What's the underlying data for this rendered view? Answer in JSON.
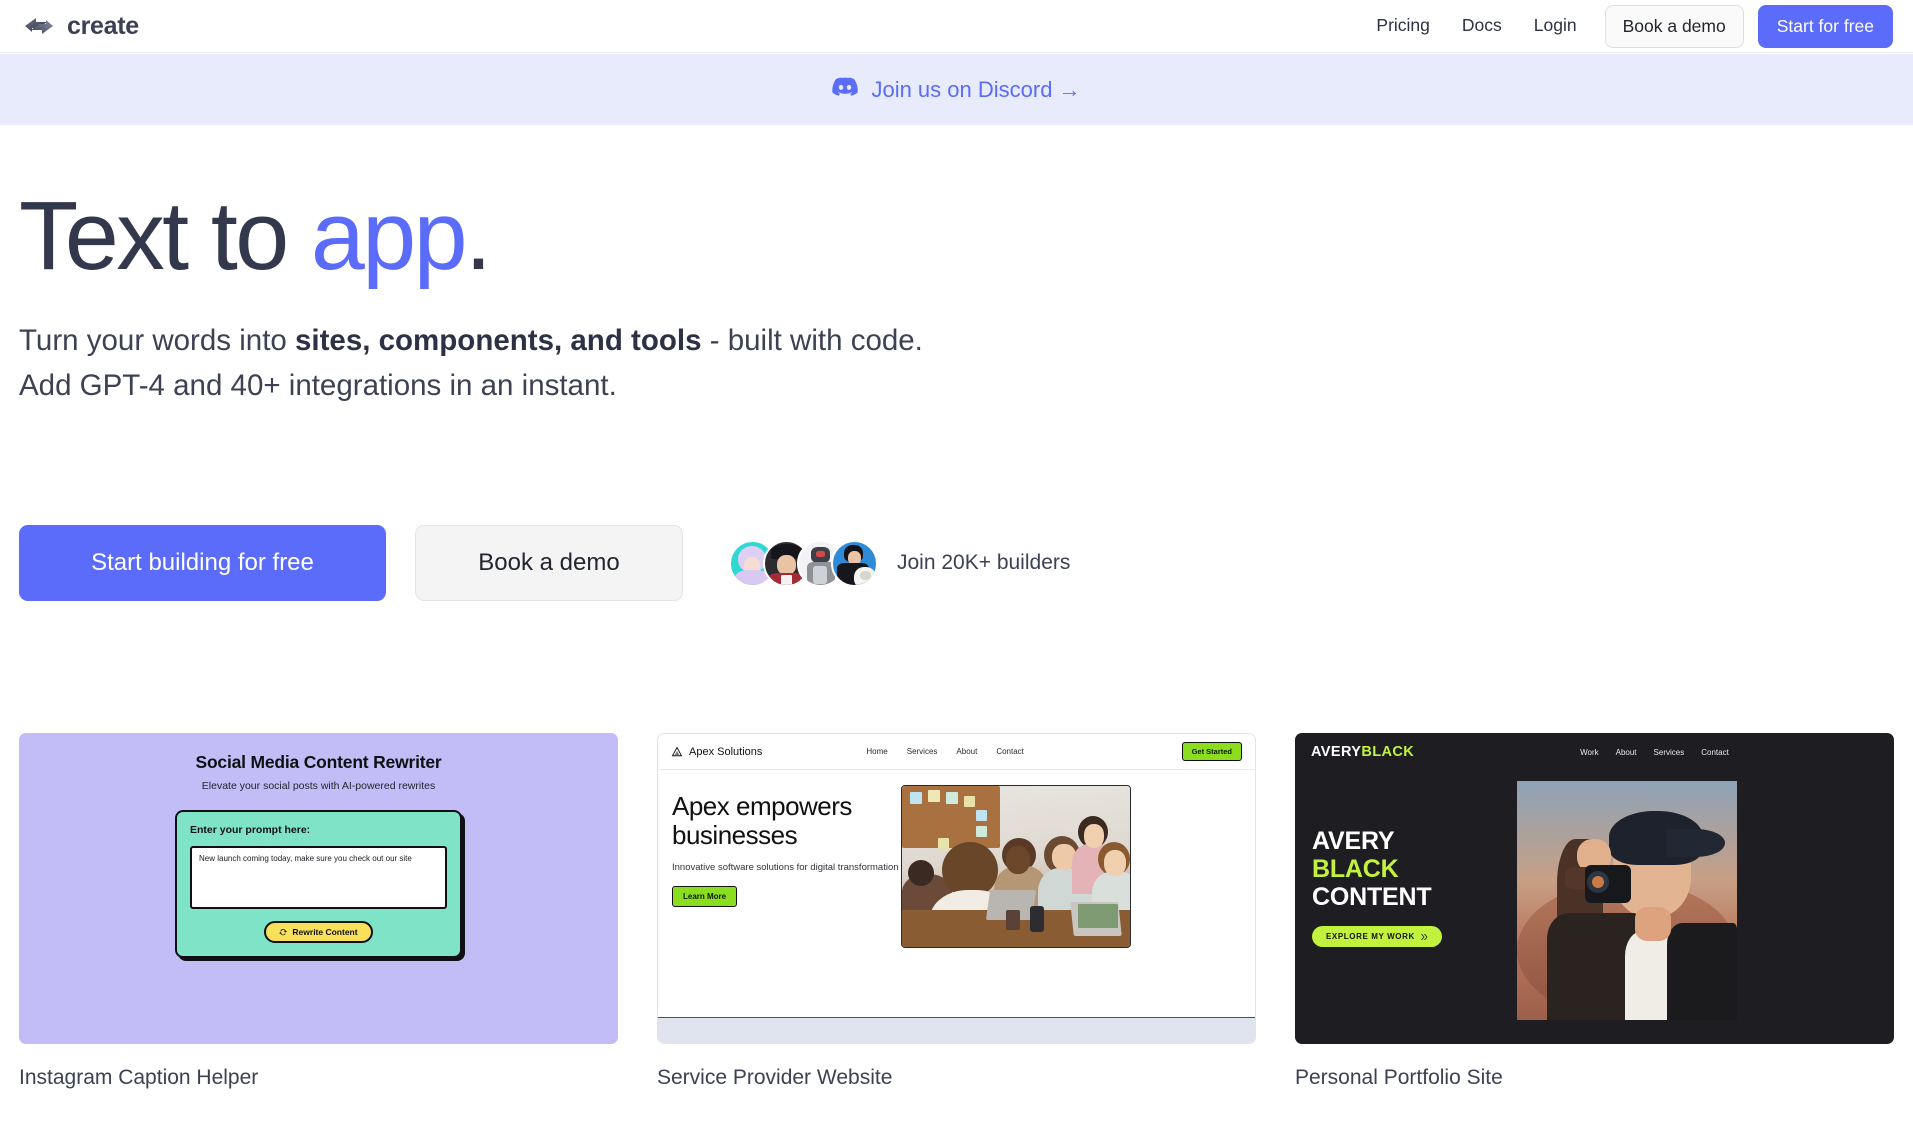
{
  "brand": {
    "name": "create",
    "logo_icon": "create-logo-icon"
  },
  "nav": {
    "links": [
      {
        "label": "Pricing"
      },
      {
        "label": "Docs"
      },
      {
        "label": "Login"
      }
    ],
    "book_demo": "Book a demo",
    "start_free": "Start for free"
  },
  "banner": {
    "icon": "discord-icon",
    "text": "Join us on Discord →",
    "bg_color": "#e8ebfb",
    "text_color": "#5b6bfa"
  },
  "hero": {
    "headline_plain": "Text to ",
    "headline_accent": "app",
    "headline_period": ".",
    "accent_color": "#5b6bfa",
    "sub_line1_a": "Turn your words into ",
    "sub_line1_b": "sites, components, and tools",
    "sub_line1_c": " - built with code.",
    "sub_line2": "Add GPT-4 and 40+ integrations in an instant.",
    "cta_primary": "Start building for free",
    "cta_secondary": "Book a demo",
    "social_proof": "Join 20K+ builders",
    "avatars": [
      {
        "name": "avatar-anime-girl"
      },
      {
        "name": "avatar-person-cap"
      },
      {
        "name": "avatar-mech-figure"
      },
      {
        "name": "avatar-person-dog"
      }
    ]
  },
  "cards": [
    {
      "caption": "Instagram Caption Helper",
      "bg_color": "#c2bdf7",
      "title": "Social Media Content Rewriter",
      "subtitle": "Elevate your social posts with AI-powered rewrites",
      "panel_color": "#7fe3c8",
      "field_label": "Enter your prompt here:",
      "field_value": "New launch coming today, make sure you check out our site",
      "button_label": "Rewrite Content",
      "button_icon": "refresh-icon",
      "button_color": "#f8e05a"
    },
    {
      "caption": "Service Provider Website",
      "logo": "Apex Solutions",
      "logo_icon": "apex-triangle-icon",
      "links": [
        "Home",
        "Services",
        "About",
        "Contact"
      ],
      "nav_cta": "Get Started",
      "heading": "Apex empowers businesses",
      "subheading": "Innovative software solutions for digital transformation",
      "button_label": "Learn More",
      "accent_color": "#8ade1f",
      "photo": "team-meeting-photo"
    },
    {
      "caption": "Personal Portfolio Site",
      "logo_a": "AVERY",
      "logo_b": "BLACK",
      "links": [
        "Work",
        "About",
        "Services",
        "Contact"
      ],
      "heading_l1": "AVERY",
      "heading_l2": "BLACK",
      "heading_l3": "CONTENT",
      "button_label": "EXPLORE MY WORK",
      "button_icon": "chevron-double-right-icon",
      "accent_color": "#c2f23e",
      "bg_color": "#1e1e22",
      "photo": "photographer-desert-photo"
    }
  ]
}
